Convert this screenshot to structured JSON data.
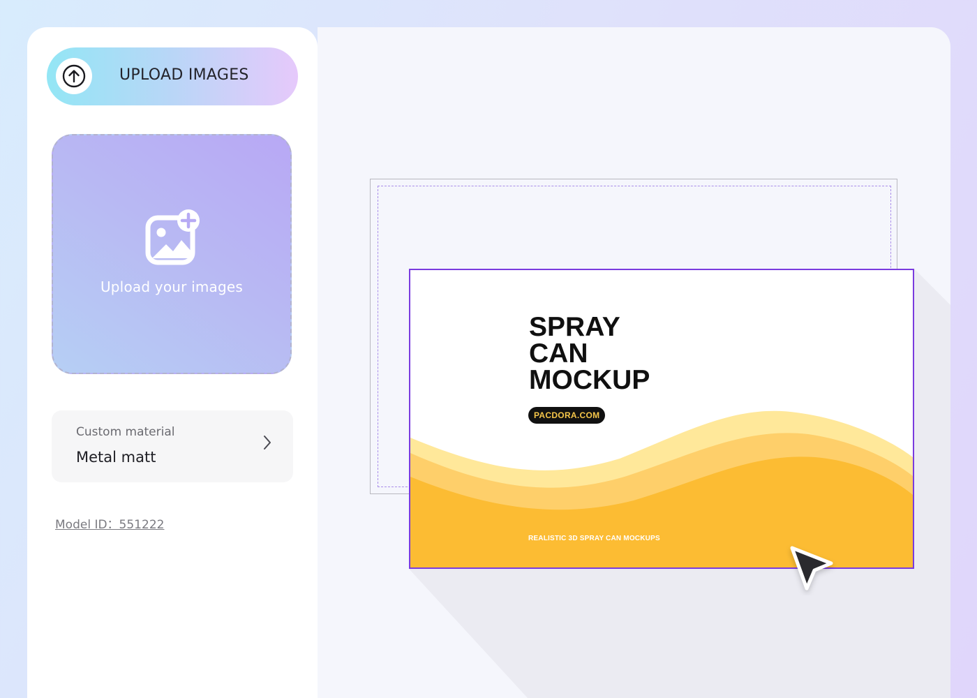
{
  "sidebar": {
    "upload_button": {
      "label": "UPLOAD IMAGES",
      "icon": "arrow-up-circle-icon"
    },
    "dropzone": {
      "label": "Upload your images",
      "icon": "image-add-icon"
    },
    "material": {
      "label": "Custom material",
      "value": "Metal matt",
      "icon": "chevron-right-icon"
    },
    "model_id": "Model ID：551222"
  },
  "artboard": {
    "title_lines": [
      "SPRAY",
      "CAN",
      "MOCKUP"
    ],
    "badge": "PACDORA.COM",
    "tagline": "REALISTIC 3D SPRAY CAN MOCKUPS",
    "colors": {
      "wave_light": "#ffe89a",
      "wave_mid": "#fecf6a",
      "wave_deep": "#fcbc33",
      "selection": "#7a3bdf"
    }
  },
  "pointer": {
    "icon": "cursor-arrow-icon"
  }
}
